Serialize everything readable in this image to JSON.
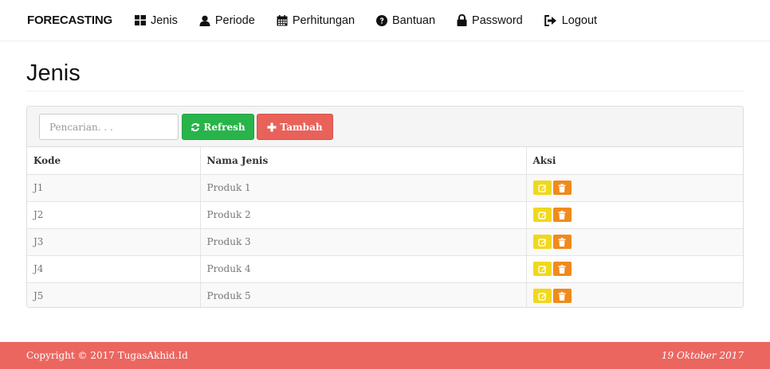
{
  "nav": {
    "brand": "FORECASTING",
    "items": [
      {
        "label": "Jenis",
        "icon": "th-large-icon"
      },
      {
        "label": "Periode",
        "icon": "user-icon"
      },
      {
        "label": "Perhitungan",
        "icon": "calendar-icon"
      },
      {
        "label": "Bantuan",
        "icon": "question-circle-icon"
      },
      {
        "label": "Password",
        "icon": "lock-icon"
      },
      {
        "label": "Logout",
        "icon": "logout-icon"
      }
    ]
  },
  "page": {
    "title": "Jenis"
  },
  "toolbar": {
    "search_placeholder": "Pencarian. . .",
    "search_value": "",
    "refresh_label": "Refresh",
    "add_label": "Tambah"
  },
  "table": {
    "headers": [
      "Kode",
      "Nama Jenis",
      "Aksi"
    ],
    "rows": [
      {
        "kode": "J1",
        "nama": "Produk 1"
      },
      {
        "kode": "J2",
        "nama": "Produk 2"
      },
      {
        "kode": "J3",
        "nama": "Produk 3"
      },
      {
        "kode": "J4",
        "nama": "Produk 4"
      },
      {
        "kode": "J5",
        "nama": "Produk 5"
      }
    ]
  },
  "footer": {
    "copyright": "Copyright © 2017 TugasAkhid.Id",
    "date": "19 Oktober 2017"
  },
  "colors": {
    "refresh": "#28b44a",
    "add": "#e8625a",
    "edit": "#f0d81c",
    "delete": "#f08a1c",
    "footer": "#ec6660"
  }
}
